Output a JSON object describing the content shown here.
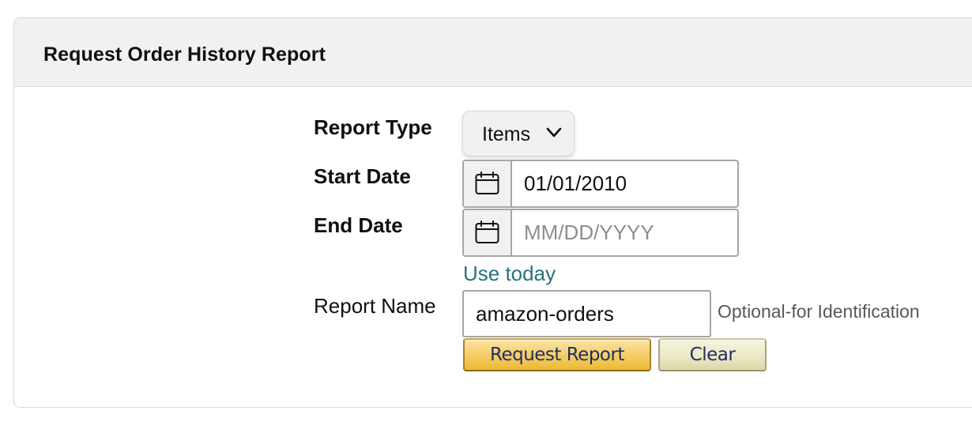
{
  "panel": {
    "title": "Request Order History Report"
  },
  "form": {
    "report_type": {
      "label": "Report Type",
      "selected": "Items"
    },
    "start_date": {
      "label": "Start Date",
      "value": "01/01/2010",
      "placeholder": "MM/DD/YYYY",
      "icon": "calendar-icon"
    },
    "end_date": {
      "label": "End Date",
      "value": "",
      "placeholder": "MM/DD/YYYY",
      "icon": "calendar-icon"
    },
    "use_today_link": "Use today",
    "report_name": {
      "label": "Report Name",
      "value": "amazon-orders",
      "hint": "Optional-for Identification"
    },
    "buttons": {
      "request": "Request Report",
      "clear": "Clear"
    }
  },
  "colors": {
    "link": "#2a7280",
    "header_bg": "#f0f2f2",
    "primary_button": "#f6d06e",
    "secondary_button": "#ece9c6",
    "button_text": "#1f2e66"
  }
}
